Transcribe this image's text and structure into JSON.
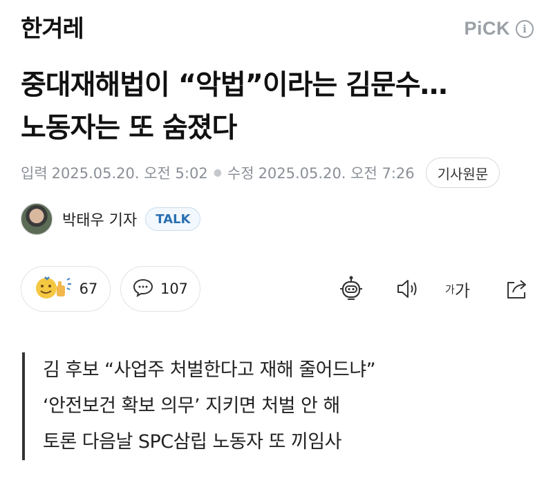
{
  "header": {
    "logo_text": "한겨레",
    "pick_label": "PiCK",
    "info_icon": "i"
  },
  "article": {
    "headline_line1": "중대재해법이 “악법”이라는 김문수…",
    "headline_line2": "노동자는 또 숨졌다",
    "meta": {
      "input_label": "입력",
      "input_time": "2025.05.20. 오전 5:02",
      "edit_label": "수정",
      "edit_time": "2025.05.20. 오전 7:26",
      "original_button": "기사원문"
    },
    "author": {
      "name": "박태우 기자",
      "talk_badge": "TALK"
    },
    "reactions": {
      "like_count": "67",
      "comment_count": "107"
    },
    "toolbar": {
      "font_small": "가",
      "font_large": "가"
    },
    "summary": [
      "김 후보 “사업주 처벌한다고 재해 줄어드냐”",
      "‘안전보건 확보 의무’ 지키면 처벌 안 해",
      "토론 다음날 SPC삼립 노동자 또 끼임사"
    ]
  },
  "colors": {
    "meta_gray": "#8a8f96",
    "talk_blue": "#2a6fb0",
    "emoji_yellow": "#f5c842"
  }
}
